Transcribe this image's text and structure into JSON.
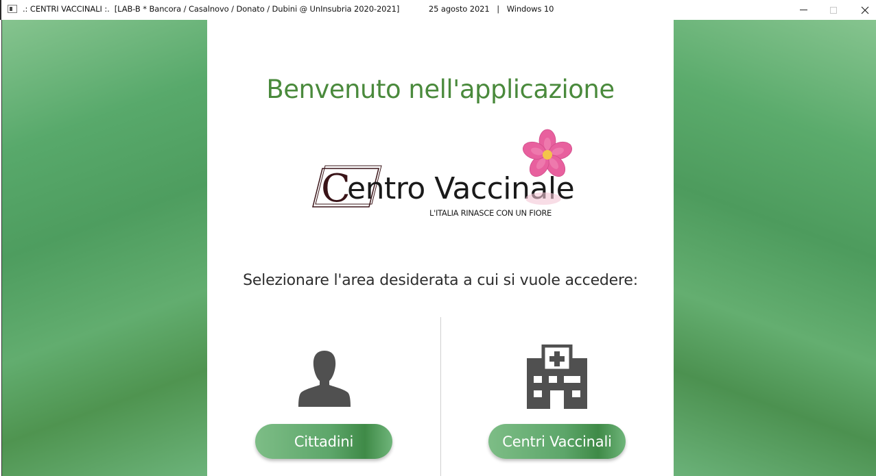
{
  "window": {
    "title": ".: CENTRI VACCINALI :.  [LAB-B * Bancora / Casalnovo / Donato / Dubini @ UnInsubria 2020-2021]            25 agosto 2021   |   Windows 10"
  },
  "main": {
    "heading": "Benvenuto nell'applicazione",
    "logo": {
      "initial": "C",
      "name": "entro Vaccinale",
      "tagline": "L'ITALIA RINASCE CON UN FIORE"
    },
    "prompt": "Selezionare l'area desiderata a cui si vuole accedere:",
    "options": [
      {
        "icon": "user-icon",
        "label": "Cittadini"
      },
      {
        "icon": "hospital-icon",
        "label": "Centri Vaccinali"
      }
    ]
  },
  "colors": {
    "heading": "#4a8a3c",
    "flower": "#e8609e",
    "flower_center": "#f4c44a",
    "logo_text": "#3a1418",
    "button_green": "#5da66a"
  }
}
